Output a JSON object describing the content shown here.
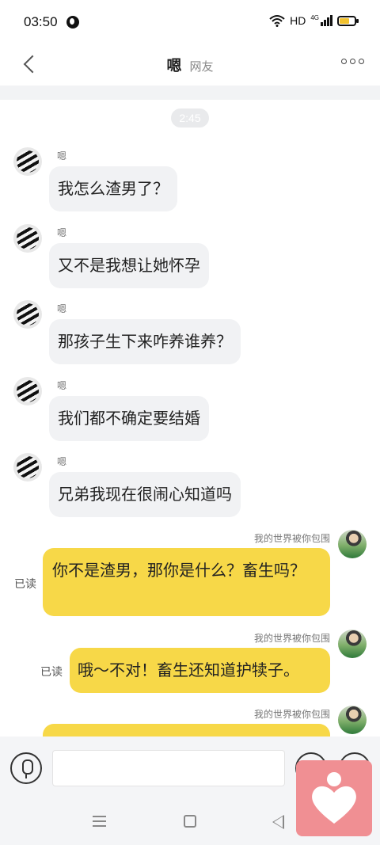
{
  "status_bar": {
    "time": "03:50",
    "network": "HD",
    "network_gen": "4G"
  },
  "header": {
    "title": "嗯",
    "subtitle": "网友"
  },
  "chat": {
    "timestamp": "2:45",
    "incoming": [
      {
        "sender": "嗯",
        "text": "我怎么渣男了？"
      },
      {
        "sender": "嗯",
        "text": "又不是我想让她怀孕"
      },
      {
        "sender": "嗯",
        "text": "那孩子生下来咋养谁养？"
      },
      {
        "sender": "嗯",
        "text": "我们都不确定要结婚"
      },
      {
        "sender": "嗯",
        "text": "兄弟我现在很闹心知道吗"
      }
    ],
    "outgoing": [
      {
        "sender": "我的世界被你包围",
        "text": "你不是渣男，那你是什么？畜生吗？",
        "read": "已读"
      },
      {
        "sender": "我的世界被你包围",
        "text": "哦～不对！畜生还知道护犊子。",
        "read": "已读"
      },
      {
        "sender": "我的世界被你包围",
        "text": "",
        "read": ""
      }
    ]
  },
  "colors": {
    "outgoing_bubble": "#f7d848",
    "incoming_bubble": "#f1f2f4",
    "floating_app": "#f08f93"
  }
}
